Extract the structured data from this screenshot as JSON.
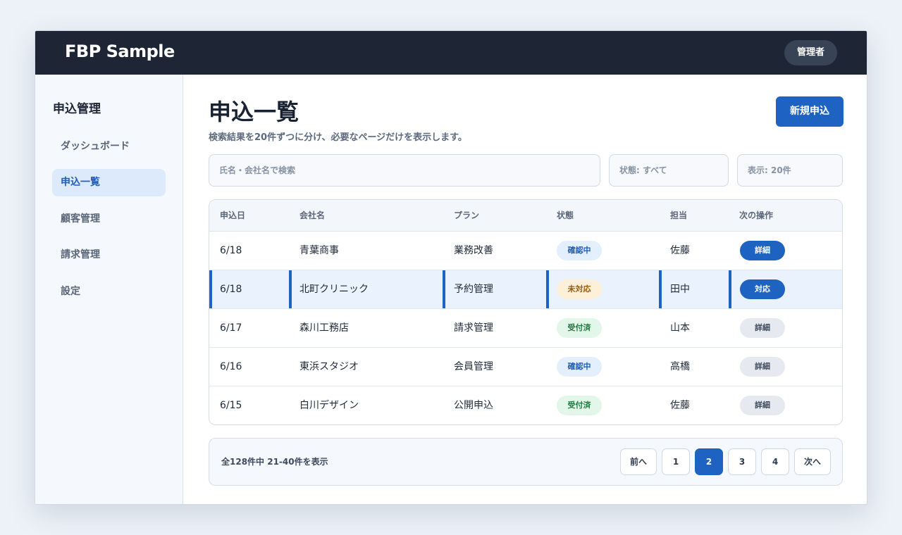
{
  "app": {
    "brand": "FBP Sample",
    "role": "管理者"
  },
  "sidebar": {
    "title": "申込管理",
    "items": [
      {
        "label": "ダッシュボード",
        "active": false
      },
      {
        "label": "申込一覧",
        "active": true
      },
      {
        "label": "顧客管理",
        "active": false
      },
      {
        "label": "請求管理",
        "active": false
      },
      {
        "label": "設定",
        "active": false
      }
    ]
  },
  "page": {
    "title": "申込一覧",
    "description": "検索結果を20件ずつに分け、必要なページだけを表示します。",
    "new_button": "新規申込"
  },
  "filters": {
    "search_placeholder": "氏名・会社名で検索",
    "status_select": "状態: すべて",
    "page_size_select": "表示: 20件"
  },
  "table": {
    "headers": [
      "申込日",
      "会社名",
      "プラン",
      "状態",
      "担当",
      "次の操作"
    ],
    "rows": [
      {
        "date": "6/18",
        "company": "青葉商事",
        "plan": "業務改善",
        "status": "確認中",
        "status_kind": "confirm",
        "owner": "佐藤",
        "action": "詳細",
        "action_kind": "primary",
        "highlight": false
      },
      {
        "date": "6/18",
        "company": "北町クリニック",
        "plan": "予約管理",
        "status": "未対応",
        "status_kind": "pending",
        "owner": "田中",
        "action": "対応",
        "action_kind": "primary",
        "highlight": true
      },
      {
        "date": "6/17",
        "company": "森川工務店",
        "plan": "請求管理",
        "status": "受付済",
        "status_kind": "done",
        "owner": "山本",
        "action": "詳細",
        "action_kind": "secondary",
        "highlight": false
      },
      {
        "date": "6/16",
        "company": "東浜スタジオ",
        "plan": "会員管理",
        "status": "確認中",
        "status_kind": "confirm",
        "owner": "高橋",
        "action": "詳細",
        "action_kind": "secondary",
        "highlight": false
      },
      {
        "date": "6/15",
        "company": "白川デザイン",
        "plan": "公開申込",
        "status": "受付済",
        "status_kind": "done",
        "owner": "佐藤",
        "action": "詳細",
        "action_kind": "secondary",
        "highlight": false
      }
    ]
  },
  "pagination": {
    "summary": "全128件中 21-40件を表示",
    "prev": "前へ",
    "next": "次へ",
    "pages": [
      "1",
      "2",
      "3",
      "4"
    ],
    "current": "2"
  },
  "colors": {
    "topbar": "#1e2636",
    "accent": "#1e63c1",
    "badge_confirm": "#e3effd",
    "badge_pending": "#fdf0d9",
    "badge_done": "#e3f6ea"
  }
}
